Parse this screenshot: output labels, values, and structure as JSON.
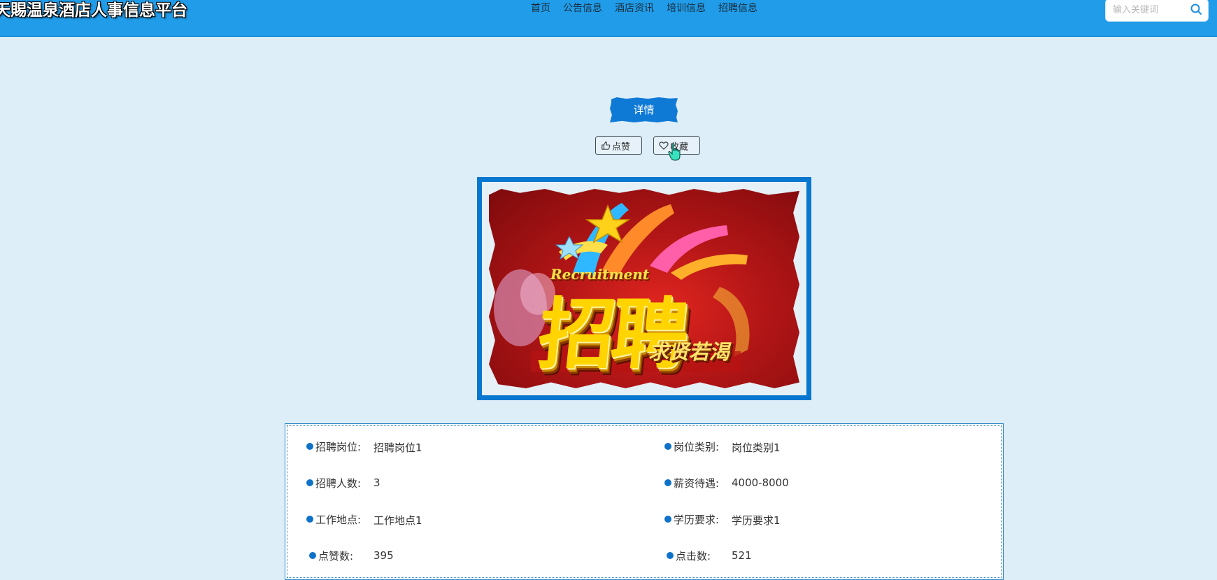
{
  "header": {
    "site_title": "天賜温泉酒店人事信息平台",
    "nav": [
      "首页",
      "公告信息",
      "酒店资讯",
      "培训信息",
      "招聘信息"
    ],
    "search_placeholder": "输入关键词"
  },
  "detail": {
    "tag_label": "详情",
    "like_label": "点赞",
    "favorite_label": "收藏"
  },
  "poster": {
    "english_text": "Recruitment",
    "chinese_text": "招聘",
    "subtitle": "求贤若渴"
  },
  "info": {
    "position_label": "招聘岗位:",
    "position_value": "招聘岗位1",
    "category_label": "岗位类别:",
    "category_value": "岗位类别1",
    "headcount_label": "招聘人数:",
    "headcount_value": "3",
    "salary_label": "薪资待遇:",
    "salary_value": "4000-8000",
    "location_label": "工作地点:",
    "location_value": "工作地点1",
    "education_label": "学历要求:",
    "education_value": "学历要求1",
    "likes_label": "点赞数:",
    "likes_value": "395",
    "clicks_label": "点击数:",
    "clicks_value": "521"
  },
  "colors": {
    "header_bg": "#209ce9",
    "page_bg": "#ddeef8",
    "accent": "#0f7ad6"
  }
}
